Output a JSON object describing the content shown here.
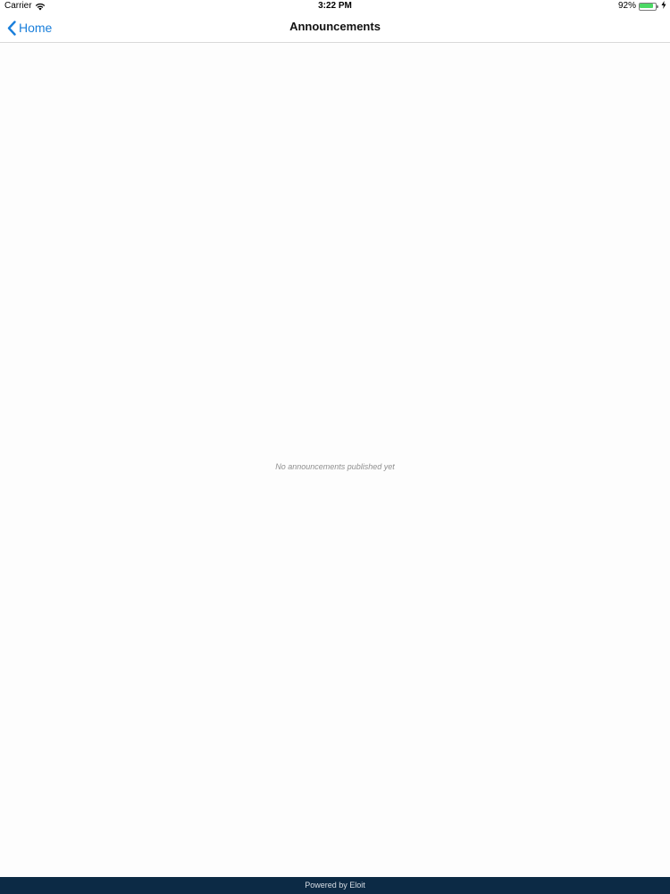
{
  "status_bar": {
    "carrier": "Carrier",
    "time": "3:22 PM",
    "battery_percent": "92%",
    "battery_level": 0.92,
    "icons": [
      "wifi-icon",
      "battery-icon",
      "charging-icon"
    ]
  },
  "nav": {
    "back_label": "Home",
    "title": "Announcements",
    "accent_color": "#1a7fdb"
  },
  "content": {
    "empty_message": "No announcements published yet"
  },
  "footer": {
    "text": "Powered by Eloit",
    "background_color": "#0c2a45"
  }
}
